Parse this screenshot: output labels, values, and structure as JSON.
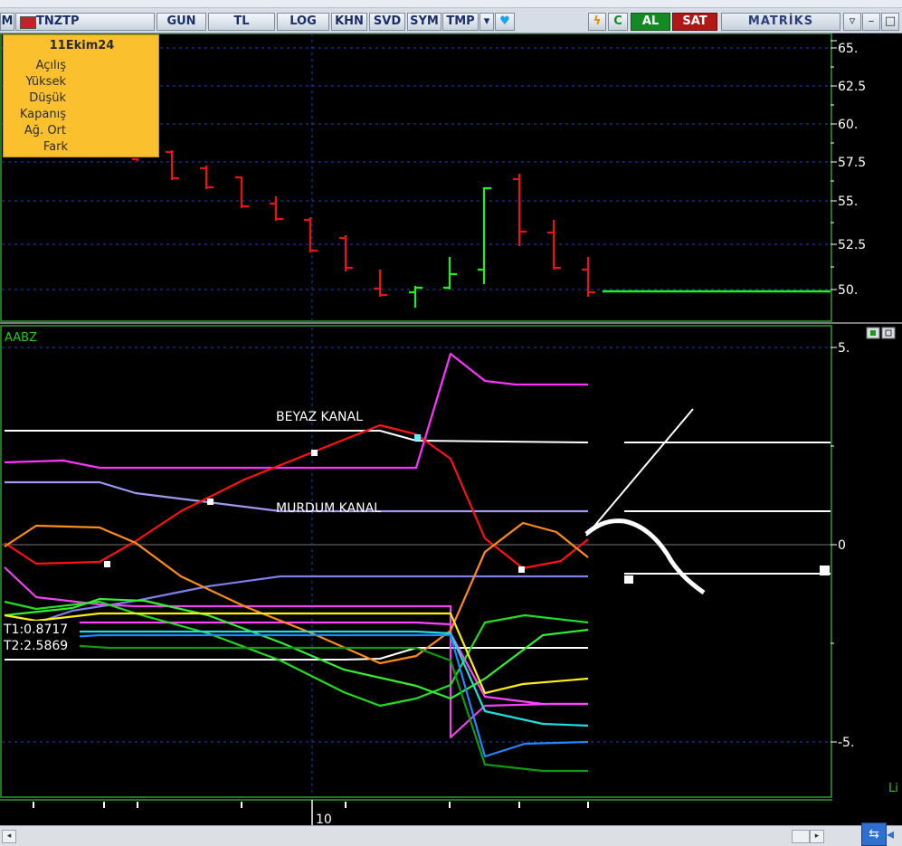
{
  "toolbar": {
    "m_label": "M",
    "symbol": "TNZTP",
    "period": "GUN",
    "currency": "TL",
    "log": "LOG",
    "khn": "KHN",
    "svd": "SVD",
    "sym": "SYM",
    "tmp": "TMP",
    "c_label": "C",
    "buy": "AL",
    "sell": "SAT",
    "brand": "MATRİKS"
  },
  "info_box": {
    "date": "11Ekim24",
    "labels": [
      "Açılış",
      "Yüksek",
      "Düşük",
      "Kapanış",
      "Ağ. Ort",
      "Fark"
    ]
  },
  "price_panel": {
    "y_ticks": [
      "65.",
      "62.5",
      "60.",
      "57.5",
      "55.",
      "52.5",
      "50."
    ]
  },
  "indicator_panel": {
    "title": "AABZ",
    "y_ticks": [
      "5.",
      "0",
      "-5."
    ],
    "annotations": {
      "beyaz": "BEYAZ KANAL",
      "murdum": "MURDUM KANAL",
      "t1": "T1:0.8717",
      "t2": "T2:2.5869"
    },
    "corner_label": "Li"
  },
  "time_axis": {
    "label": "10"
  },
  "colors": {
    "grid": "#1f3fbf",
    "panel_border": "#2f9a2f",
    "up_bar": "#22ee22",
    "down_bar": "#ee1111",
    "info_bg": "#fbc02d"
  }
}
